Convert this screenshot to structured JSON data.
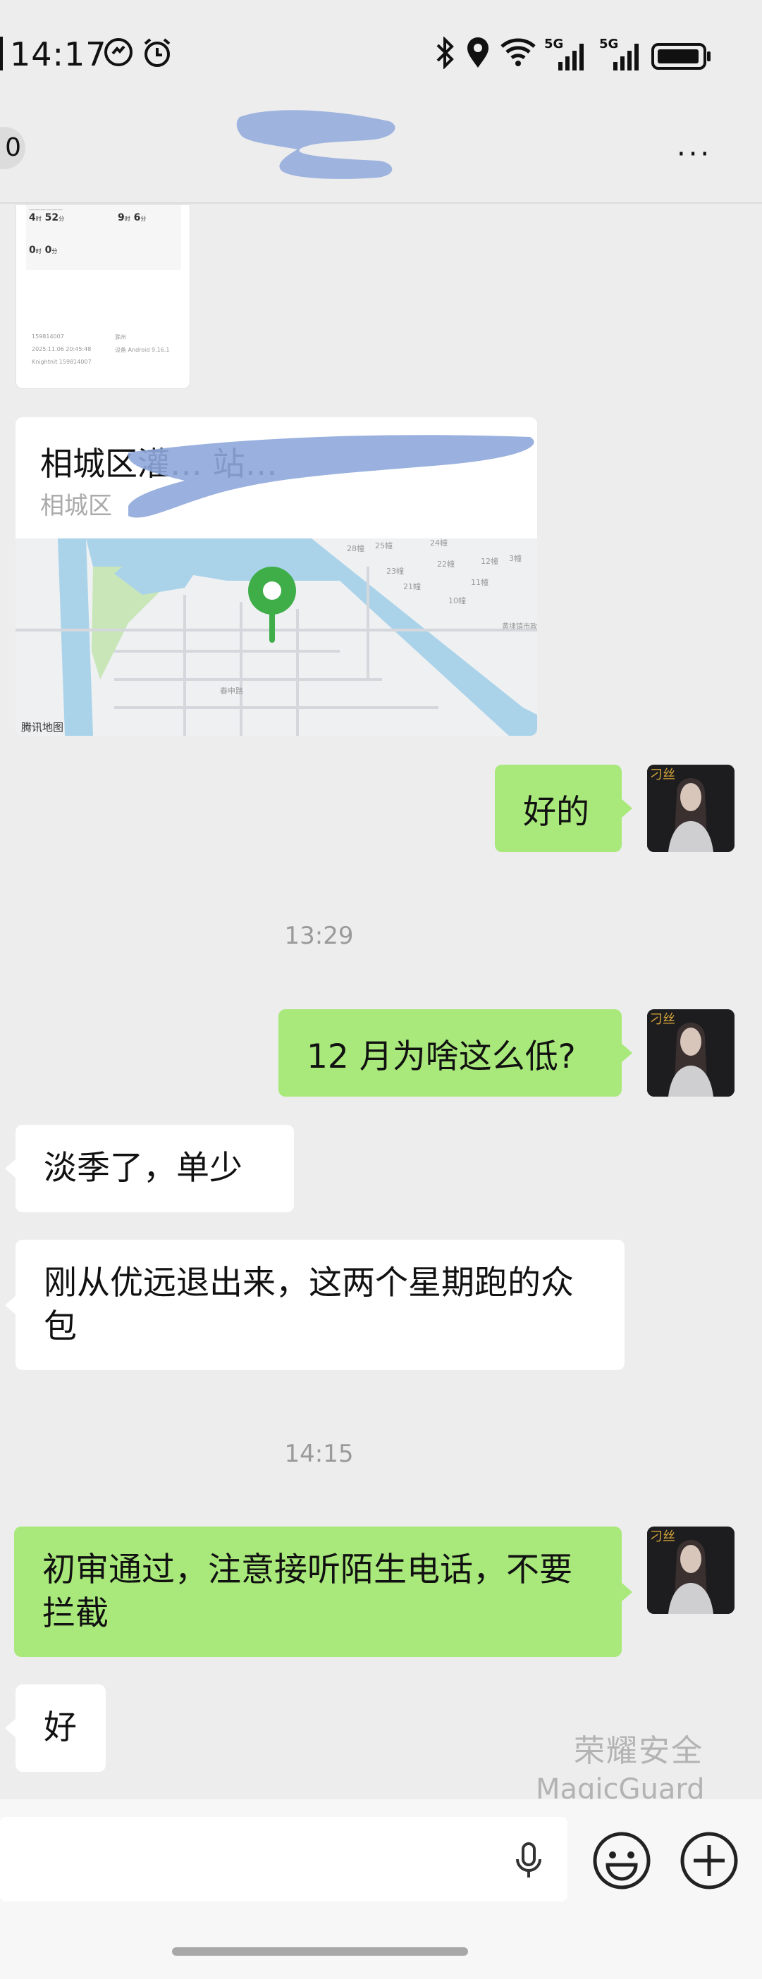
{
  "status_bar": {
    "time": "14:17",
    "network_labels": [
      "5G",
      "5G"
    ]
  },
  "header": {
    "back_count": "0",
    "more_label": "···"
  },
  "shared_screenshot": {
    "stat_1_value": "4",
    "stat_1_unit_a": "时",
    "stat_1_minutes": "52",
    "stat_1_unit_b": "分",
    "stat_2_value": "9",
    "stat_2_unit_a": "时",
    "stat_2_minutes": "6",
    "stat_2_unit_b": "分",
    "stat_3_value": "0",
    "stat_3_unit_a": "时",
    "stat_3_minutes": "0",
    "stat_3_unit_b": "分",
    "row_1": "159814007",
    "row_1_right": "滁州",
    "row_2": "2025.11.06 20:45:48",
    "row_2_right": "设备 Android 9.16.1",
    "row_3": "Knightnit 159814007"
  },
  "location_message": {
    "title": "相城区灌…                                   站…",
    "subtitle": "相城区",
    "map_brand": "腾讯地图",
    "map_labels": [
      "28幢",
      "25幢",
      "24幢",
      "23幢",
      "22幢",
      "12幢",
      "3幢",
      "11幢",
      "21幢",
      "10幢",
      "黄埭镇市政管理所",
      "春申路"
    ]
  },
  "messages": [
    {
      "side": "right",
      "text": "好的"
    },
    {
      "type": "time",
      "text": "13:29"
    },
    {
      "side": "right",
      "text": "12 月为啥这么低?"
    },
    {
      "side": "left",
      "text": "淡季了，单少"
    },
    {
      "side": "left",
      "text": "刚从优远退出来，这两个星期跑的众包"
    },
    {
      "type": "time",
      "text": "14:15"
    },
    {
      "side": "right",
      "text": "初审通过，注意接听陌生电话，不要拦截"
    },
    {
      "side": "left",
      "text": "好"
    }
  ],
  "avatar": {
    "label": "刁丝"
  },
  "watermark": {
    "line1": "荣耀安全",
    "line2": "MagicGuard"
  },
  "colors": {
    "background": "#ededed",
    "bubble_sent": "#a9e97b",
    "bubble_received": "#ffffff",
    "timestamp": "#9a9a9a",
    "map_pin": "#3fae49",
    "map_water": "#aad3ea"
  },
  "icons": {
    "status": [
      "dnd-icon",
      "alarm-icon",
      "bluetooth-icon",
      "location-icon",
      "wifi-icon",
      "signal-icon",
      "signal-icon",
      "battery-icon"
    ],
    "input": [
      "mic-icon",
      "emoji-icon",
      "plus-icon"
    ]
  }
}
